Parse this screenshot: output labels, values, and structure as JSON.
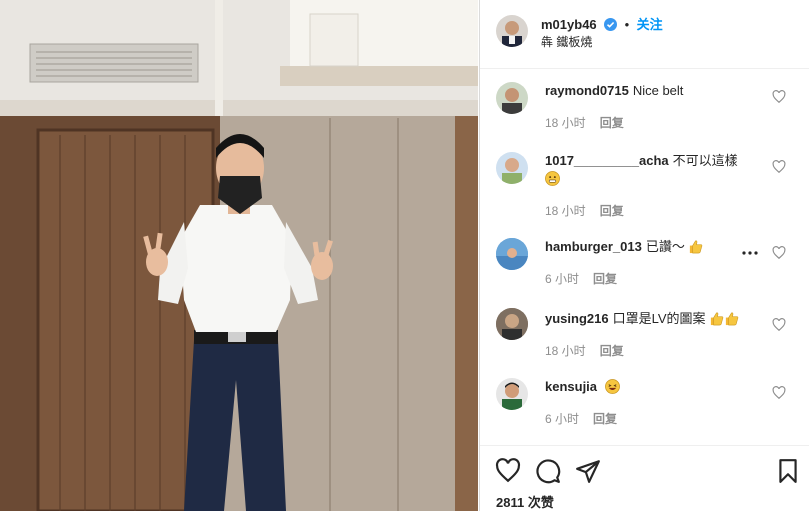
{
  "post": {
    "username": "m01yb46",
    "follow_label": "关注",
    "location": "犇 鐵板燒",
    "likes": "2811 次赞"
  },
  "comments": [
    {
      "user": "raymond0715",
      "text": "Nice belt",
      "time": "18 小时",
      "reply": "回复"
    },
    {
      "user": "1017_________acha",
      "text": "不可以這樣",
      "time": "18 小时",
      "reply": "回复"
    },
    {
      "user": "hamburger_013",
      "text": "已讚～",
      "time": "6 小时",
      "reply": "回复"
    },
    {
      "user": "yusing216",
      "text": "口罩是LV的圖案",
      "time": "18 小时",
      "reply": "回复"
    },
    {
      "user": "kensujia",
      "text": "",
      "time": "6 小时",
      "reply": "回复"
    }
  ],
  "colors": {
    "verified": "#3897f0",
    "follow": "#0095f6",
    "annotation": "#9e1b1b"
  },
  "icons": [
    "verified-badge-icon",
    "heart-icon",
    "comment-icon",
    "share-icon",
    "bookmark-icon",
    "more-icon",
    "thumbs-up-emoji",
    "grimace-emoji",
    "laughing-emoji"
  ]
}
